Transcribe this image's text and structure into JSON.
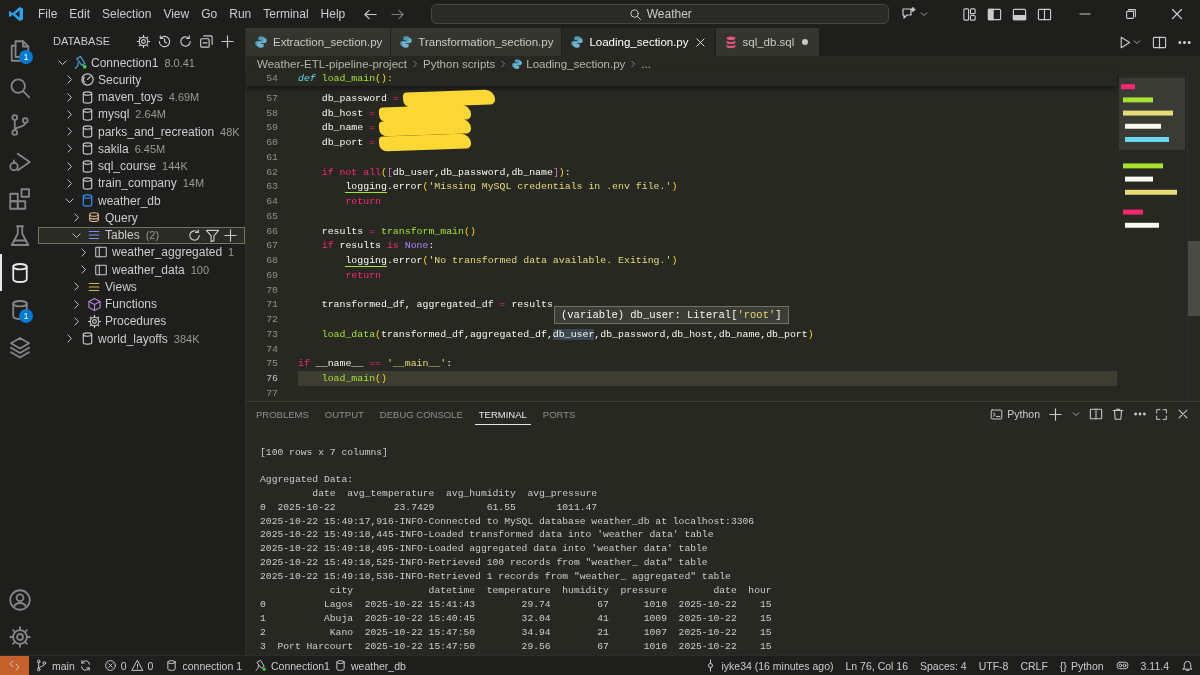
{
  "titlebar": {
    "menu": [
      "File",
      "Edit",
      "Selection",
      "View",
      "Go",
      "Run",
      "Terminal",
      "Help"
    ],
    "search": {
      "value": "Weather"
    }
  },
  "activity_bar": {
    "items": [
      {
        "kind": "files",
        "badge": "1",
        "selected": false
      },
      {
        "kind": "search",
        "selected": false
      },
      {
        "kind": "branch",
        "selected": false
      },
      {
        "kind": "debug",
        "selected": false
      },
      {
        "kind": "extensions",
        "selected": false
      },
      {
        "kind": "flask",
        "selected": false
      },
      {
        "kind": "db",
        "selected": true
      },
      {
        "kind": "db",
        "badge": "1",
        "selected": false
      },
      {
        "kind": "layers",
        "selected": false
      }
    ],
    "bottom": [
      {
        "kind": "account"
      },
      {
        "kind": "gear"
      }
    ]
  },
  "sidebar": {
    "title": "DATABASE",
    "tree": [
      {
        "label": "Connection1",
        "meta": "8.0.41",
        "kind": "connection",
        "expanded": true,
        "selected": false,
        "children": [
          {
            "label": "Security",
            "kind": "security",
            "expanded": false,
            "selected": false
          },
          {
            "label": "maven_toys",
            "meta": "4.69M",
            "kind": "database",
            "expanded": false,
            "selected": false
          },
          {
            "label": "mysql",
            "meta": "2.64M",
            "kind": "database",
            "expanded": false,
            "selected": false
          },
          {
            "label": "parks_and_recreation",
            "meta": "48K",
            "kind": "database",
            "expanded": false,
            "selected": false
          },
          {
            "label": "sakila",
            "meta": "6.45M",
            "kind": "database",
            "expanded": false,
            "selected": false
          },
          {
            "label": "sql_course",
            "meta": "144K",
            "kind": "database",
            "expanded": false,
            "selected": false
          },
          {
            "label": "train_company",
            "meta": "14M",
            "kind": "database",
            "expanded": false,
            "selected": false
          },
          {
            "label": "weather_db",
            "kind": "database",
            "expanded": true,
            "selected": false,
            "children": [
              {
                "label": "Query",
                "kind": "query",
                "expanded": false,
                "selected": false
              },
              {
                "label": "Tables",
                "meta": "(2)",
                "kind": "tables",
                "expanded": true,
                "selected": true,
                "children": [
                  {
                    "label": "weather_aggregated",
                    "meta": "1",
                    "kind": "table",
                    "expanded": false,
                    "selected": false
                  },
                  {
                    "label": "weather_data",
                    "meta": "100",
                    "kind": "table",
                    "expanded": false,
                    "selected": false
                  }
                ]
              },
              {
                "label": "Views",
                "kind": "views",
                "expanded": false,
                "selected": false
              },
              {
                "label": "Functions",
                "kind": "functions",
                "expanded": false,
                "selected": false
              },
              {
                "label": "Procedures",
                "kind": "procedures",
                "expanded": false,
                "selected": false
              }
            ]
          },
          {
            "label": "world_layoffs",
            "meta": "384K",
            "kind": "database",
            "expanded": false,
            "selected": false
          }
        ]
      }
    ]
  },
  "editor": {
    "tabs": [
      {
        "label": "Extraction_section.py",
        "kind": "python",
        "selected": false,
        "modified": false
      },
      {
        "label": "Transformation_section.py",
        "kind": "python",
        "selected": false,
        "modified": false
      },
      {
        "label": "Loading_section.py",
        "kind": "python",
        "selected": true,
        "modified": false
      },
      {
        "label": "sql_db.sql",
        "kind": "sql",
        "selected": false,
        "modified": true
      }
    ],
    "breadcrumb": [
      {
        "text": "Weather-ETL-pipeline-project",
        "kind": "folder"
      },
      {
        "text": "Python scripts",
        "kind": "folder"
      },
      {
        "text": "Loading_section.py",
        "kind": "python"
      },
      {
        "text": "...",
        "kind": "more"
      }
    ],
    "sticky_line": {
      "number": "54",
      "tokens": [
        {
          "kind": "def",
          "text": "def "
        },
        {
          "kind": "fn",
          "text": "load_main"
        },
        {
          "kind": "bracket",
          "text": "():"
        }
      ]
    },
    "lines": [
      {
        "number": "57",
        "redacted": true,
        "current": false,
        "tokens": [
          {
            "kind": "plain",
            "text": "    db_password"
          },
          {
            "kind": "op",
            "text": " ="
          }
        ]
      },
      {
        "number": "58",
        "redacted": true,
        "current": false,
        "tokens": [
          {
            "kind": "plain",
            "text": "    db_host"
          },
          {
            "kind": "op",
            "text": " ="
          }
        ]
      },
      {
        "number": "59",
        "redacted": true,
        "current": false,
        "tokens": [
          {
            "kind": "plain",
            "text": "    db_name"
          },
          {
            "kind": "op",
            "text": " ="
          }
        ]
      },
      {
        "number": "60",
        "redacted": true,
        "current": false,
        "tokens": [
          {
            "kind": "plain",
            "text": "    db_port"
          },
          {
            "kind": "op",
            "text": " ="
          }
        ]
      },
      {
        "number": "61",
        "redacted": false,
        "current": false
      },
      {
        "number": "62",
        "redacted": false,
        "current": false,
        "tokens": [
          {
            "kind": "kw",
            "text": "    if not all"
          },
          {
            "kind": "bracket",
            "text": "("
          },
          {
            "kind": "bracket2",
            "text": "["
          },
          {
            "kind": "plain",
            "text": "db_user,db_password,db_name"
          },
          {
            "kind": "bracket2",
            "text": "]"
          },
          {
            "kind": "bracket",
            "text": ")"
          },
          {
            "kind": "plain",
            "text": ":"
          }
        ]
      },
      {
        "number": "63",
        "redacted": false,
        "current": false,
        "tokens": [
          {
            "kind": "warned",
            "text": "        logging"
          },
          {
            "kind": "plain",
            "text": ".error"
          },
          {
            "kind": "bracket",
            "text": "("
          },
          {
            "kind": "str",
            "text": "'Missing MySQL credentials in .env file.'"
          },
          {
            "kind": "bracket",
            "text": ")"
          }
        ]
      },
      {
        "number": "64",
        "redacted": false,
        "current": false,
        "tokens": [
          {
            "kind": "kw",
            "text": "        return"
          }
        ]
      },
      {
        "number": "65",
        "redacted": false,
        "current": false
      },
      {
        "number": "66",
        "redacted": false,
        "current": false,
        "tokens": [
          {
            "kind": "plain",
            "text": "    results"
          },
          {
            "kind": "op",
            "text": " = "
          },
          {
            "kind": "fn",
            "text": "transform_main"
          },
          {
            "kind": "bracket",
            "text": "()"
          }
        ]
      },
      {
        "number": "67",
        "redacted": false,
        "current": false,
        "tokens": [
          {
            "kind": "kw",
            "text": "    if"
          },
          {
            "kind": "plain",
            "text": " results "
          },
          {
            "kind": "kw",
            "text": "is"
          },
          {
            "kind": "const",
            "text": " None"
          },
          {
            "kind": "plain",
            "text": ":"
          }
        ]
      },
      {
        "number": "68",
        "redacted": false,
        "current": false,
        "tokens": [
          {
            "kind": "warned",
            "text": "        logging"
          },
          {
            "kind": "plain",
            "text": ".error"
          },
          {
            "kind": "bracket",
            "text": "("
          },
          {
            "kind": "str",
            "text": "'No transformed data available. Exiting.'"
          },
          {
            "kind": "bracket",
            "text": ")"
          }
        ]
      },
      {
        "number": "69",
        "redacted": false,
        "current": false,
        "tokens": [
          {
            "kind": "kw",
            "text": "        return"
          }
        ]
      },
      {
        "number": "70",
        "redacted": false,
        "current": false
      },
      {
        "number": "71",
        "redacted": false,
        "current": false,
        "tokens": [
          {
            "kind": "plain",
            "text": "    transformed_df, aggregated_df"
          },
          {
            "kind": "op",
            "text": " = "
          },
          {
            "kind": "plain",
            "text": "results"
          }
        ]
      },
      {
        "number": "72",
        "redacted": false,
        "current": false
      },
      {
        "number": "73",
        "redacted": false,
        "current": false,
        "tokens": [
          {
            "kind": "fn",
            "text": "    load_data"
          },
          {
            "kind": "bracket",
            "text": "("
          },
          {
            "kind": "plain",
            "text": "transformed_df,aggregated_df,"
          },
          {
            "kind": "highlight",
            "text": "db_user"
          },
          {
            "kind": "plain",
            "text": ",db_password,db_host,db_name,db_port"
          },
          {
            "kind": "bracket",
            "text": ")"
          }
        ]
      },
      {
        "number": "74",
        "redacted": false,
        "current": false
      },
      {
        "number": "75",
        "redacted": false,
        "current": false,
        "tokens": [
          {
            "kind": "kw",
            "text": "if"
          },
          {
            "kind": "plain",
            "text": " __name__ "
          },
          {
            "kind": "op",
            "text": "=="
          },
          {
            "kind": "str",
            "text": " '__main__'"
          },
          {
            "kind": "plain",
            "text": ":"
          }
        ]
      },
      {
        "number": "76",
        "redacted": false,
        "current": true,
        "tokens": [
          {
            "kind": "fn",
            "text": "    load_main"
          },
          {
            "kind": "bracket",
            "text": "()"
          }
        ]
      },
      {
        "number": "77",
        "redacted": false,
        "current": false
      }
    ],
    "hover": {
      "tokens": [
        {
          "kind": "plain",
          "text": "(variable) db_user: Literal["
        },
        {
          "kind": "str",
          "text": "'root'"
        },
        {
          "kind": "plain",
          "text": "]"
        }
      ]
    }
  },
  "panel": {
    "tabs": [
      {
        "label": "PROBLEMS",
        "selected": false
      },
      {
        "label": "OUTPUT",
        "selected": false
      },
      {
        "label": "DEBUG CONSOLE",
        "selected": false
      },
      {
        "label": "TERMINAL",
        "selected": true
      },
      {
        "label": "PORTS",
        "selected": false
      }
    ],
    "shell": "Python",
    "terminal": [
      {
        "lines": [
          "[100 rows x 7 columns]"
        ]
      },
      {
        "lines": [
          "Aggregated Data:",
          "         date  avg_temperature  avg_humidity  avg_pressure",
          "0  2025-10-22          23.7429         61.55       1011.47",
          "2025-10-22 15:49:17,916-INFO-Connected to MySQL database weather_db at localhost:3306",
          "2025-10-22 15:49:18,445-INFO-Loaded transformed data into 'weather data' table",
          "2025-10-22 15:49:18,495-INFO-Loaded aggregated data into 'weather data' table",
          "2025-10-22 15:49:18,525-INFO-Retrieved 100 records from \"weather_ data\" table",
          "2025-10-22 15:49:18,536-INFO-Retrieved 1 records from \"weather_ aggregated\" table",
          "            city             datetime  temperature  humidity  pressure        date  hour",
          "0          Lagos  2025-10-22 15:41:43        29.74        67      1010  2025-10-22    15",
          "1          Abuja  2025-10-22 15:40:45        32.04        41      1009  2025-10-22    15",
          "2           Kano  2025-10-22 15:47:50        34.94        21      1007  2025-10-22    15",
          "3  Port Harcourt  2025-10-22 15:47:50        29.56        67      1010  2025-10-22    15"
        ]
      }
    ]
  },
  "status_bar": {
    "left": [
      {
        "kind": "remote",
        "parts": [
          {
            "kind": "remote"
          }
        ]
      },
      {
        "kind": "item",
        "parts": [
          {
            "kind": "branch"
          },
          {
            "kind": "text",
            "text": "main"
          },
          {
            "kind": "sync"
          }
        ]
      },
      {
        "kind": "item",
        "parts": [
          {
            "kind": "error"
          },
          {
            "kind": "text",
            "text": "0"
          },
          {
            "kind": "warning"
          },
          {
            "kind": "text",
            "text": "0"
          }
        ]
      },
      {
        "kind": "item",
        "parts": [
          {
            "kind": "db"
          },
          {
            "kind": "text",
            "text": "connection 1"
          }
        ]
      },
      {
        "kind": "item",
        "parts": [
          {
            "kind": "connection"
          },
          {
            "kind": "text",
            "text": "Connection1"
          },
          {
            "kind": "db"
          },
          {
            "kind": "text",
            "text": "weather_db"
          }
        ]
      }
    ],
    "right": [
      {
        "parts": [
          {
            "kind": "commit"
          },
          {
            "kind": "text",
            "text": "iyke34 (16 minutes ago)"
          }
        ]
      },
      {
        "parts": [
          {
            "kind": "text",
            "text": "Ln 76, Col 16"
          }
        ]
      },
      {
        "parts": [
          {
            "kind": "text",
            "text": "Spaces: 4"
          }
        ]
      },
      {
        "parts": [
          {
            "kind": "text",
            "text": "UTF-8"
          }
        ]
      },
      {
        "parts": [
          {
            "kind": "text",
            "text": "CRLF"
          }
        ]
      },
      {
        "parts": [
          {
            "kind": "text",
            "text": "{}"
          },
          {
            "kind": "text",
            "text": "Python"
          }
        ]
      },
      {
        "parts": [
          {
            "kind": "goggles"
          }
        ]
      },
      {
        "parts": [
          {
            "kind": "text",
            "text": "3.11.4"
          }
        ]
      },
      {
        "parts": [
          {
            "kind": "bell"
          }
        ]
      }
    ]
  }
}
